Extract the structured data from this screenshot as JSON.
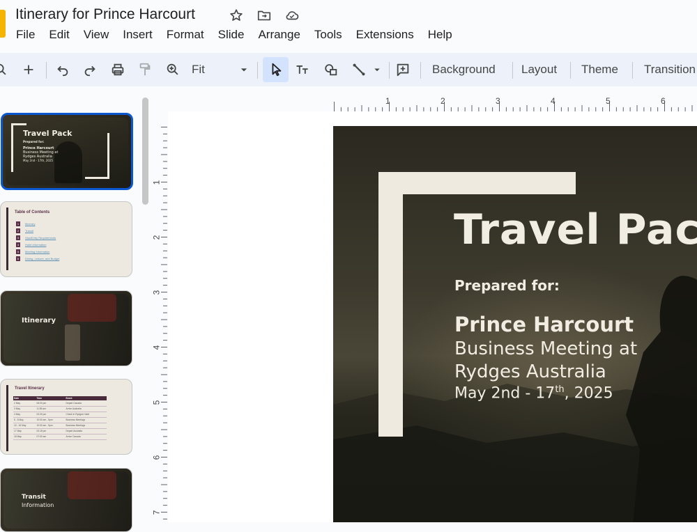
{
  "app": {
    "doc_title": "Itinerary for Prince Harcourt",
    "title_icons": [
      "star-icon",
      "move-folder-icon",
      "cloud-saved-icon"
    ]
  },
  "menu": [
    "File",
    "Edit",
    "View",
    "Insert",
    "Format",
    "Slide",
    "Arrange",
    "Tools",
    "Extensions",
    "Help"
  ],
  "toolbar": {
    "zoom_value": "Fit",
    "background_label": "Background",
    "layout_label": "Layout",
    "theme_label": "Theme",
    "transition_label": "Transition"
  },
  "rulers": {
    "top": [
      "1",
      "2",
      "3",
      "4",
      "5",
      "6"
    ],
    "left": [
      "1",
      "2",
      "3",
      "4",
      "5",
      "6",
      "7"
    ]
  },
  "filmstrip": {
    "slide1": {
      "title": "Travel Pack",
      "prepared": "Prepared for:",
      "name": "Prince Harcourt",
      "line1": "Business Meeting at",
      "line2": "Rydges Australia",
      "dates": "May 2nd - 17th, 2025"
    },
    "slide2": {
      "title": "Table of Contents",
      "items": [
        {
          "num": "1",
          "text": "Itinerary"
        },
        {
          "num": "2",
          "text": "Transit"
        },
        {
          "num": "3",
          "text": "Visa/Entry Requirements"
        },
        {
          "num": "4",
          "text": "Hotel Information"
        },
        {
          "num": "5",
          "text": "Meeting Information"
        },
        {
          "num": "6",
          "text": "Dining, Leisure, and Budget"
        }
      ]
    },
    "slide3": {
      "title": "Itinerary"
    },
    "slide4": {
      "title": "Travel Itinerary",
      "headers": [
        "Date",
        "Time",
        "Event"
      ],
      "rows": [
        [
          "2 May",
          "06:00 pm",
          "Depart Canada"
        ],
        [
          "3 May",
          "11:55 am",
          "Arrive Australia"
        ],
        [
          "4 May",
          "02:00 pm",
          "Check in Rydges Hotel"
        ],
        [
          "5 - 8 May",
          "10:00 am - 5pm",
          "Business Meetings"
        ],
        [
          "10 - 16 May",
          "10:00 am - 5pm",
          "Business Meetings"
        ],
        [
          "17 May",
          "02:15 pm",
          "Depart Australia"
        ],
        [
          "18 May",
          "07:00 am",
          "Arrive Canada"
        ]
      ]
    },
    "slide5": {
      "title": "Transit",
      "subtitle": "Information"
    }
  },
  "slide": {
    "title": "Travel Pac",
    "prepared": "Prepared for:",
    "name": "Prince Harcourt",
    "line1": "Business Meeting at",
    "line2": "Rydges Australia",
    "date_pre": "May 2nd - 17",
    "date_sup": "th",
    "date_post": ", 2025"
  },
  "colors": {
    "accent_blue": "#0b57d0",
    "toolbar_bg": "#edf2fa",
    "slide_cream": "#eeeae0",
    "toc_plum": "#5b2f47"
  }
}
